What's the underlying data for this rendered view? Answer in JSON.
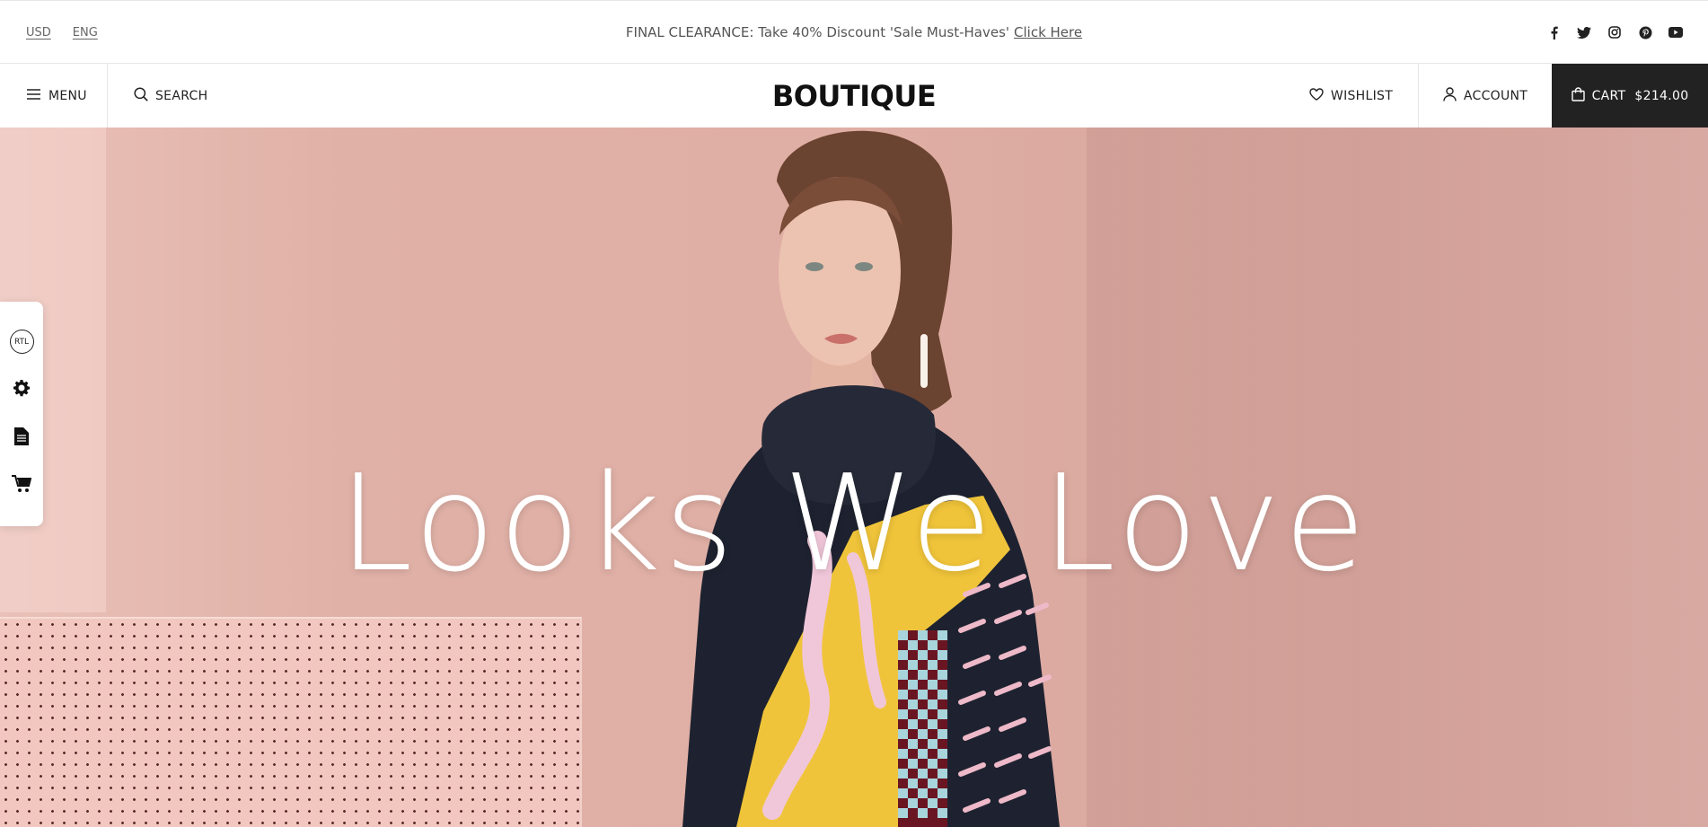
{
  "topbar": {
    "currency": "USD",
    "language": "ENG",
    "promo_text": "FINAL CLEARANCE: Take 40% Discount 'Sale Must-Haves'",
    "promo_link": "Click Here",
    "social": [
      "facebook-icon",
      "twitter-icon",
      "instagram-icon",
      "pinterest-icon",
      "youtube-icon"
    ]
  },
  "nav": {
    "menu_label": "MENU",
    "search_label": "SEARCH",
    "logo": "BOUTIQUE",
    "wishlist_label": "WISHLIST",
    "account_label": "ACCOUNT",
    "cart_label": "CART",
    "cart_total": "$214.00"
  },
  "hero": {
    "headline": "Looks We Love"
  },
  "sidetools": {
    "rtl_label": "RTL",
    "icons": [
      "rtl-icon",
      "gear-icon",
      "document-icon",
      "cart-icon"
    ]
  },
  "colors": {
    "cart_bg": "#222222",
    "hero_bg": "#dfaea4",
    "text": "#222222"
  }
}
